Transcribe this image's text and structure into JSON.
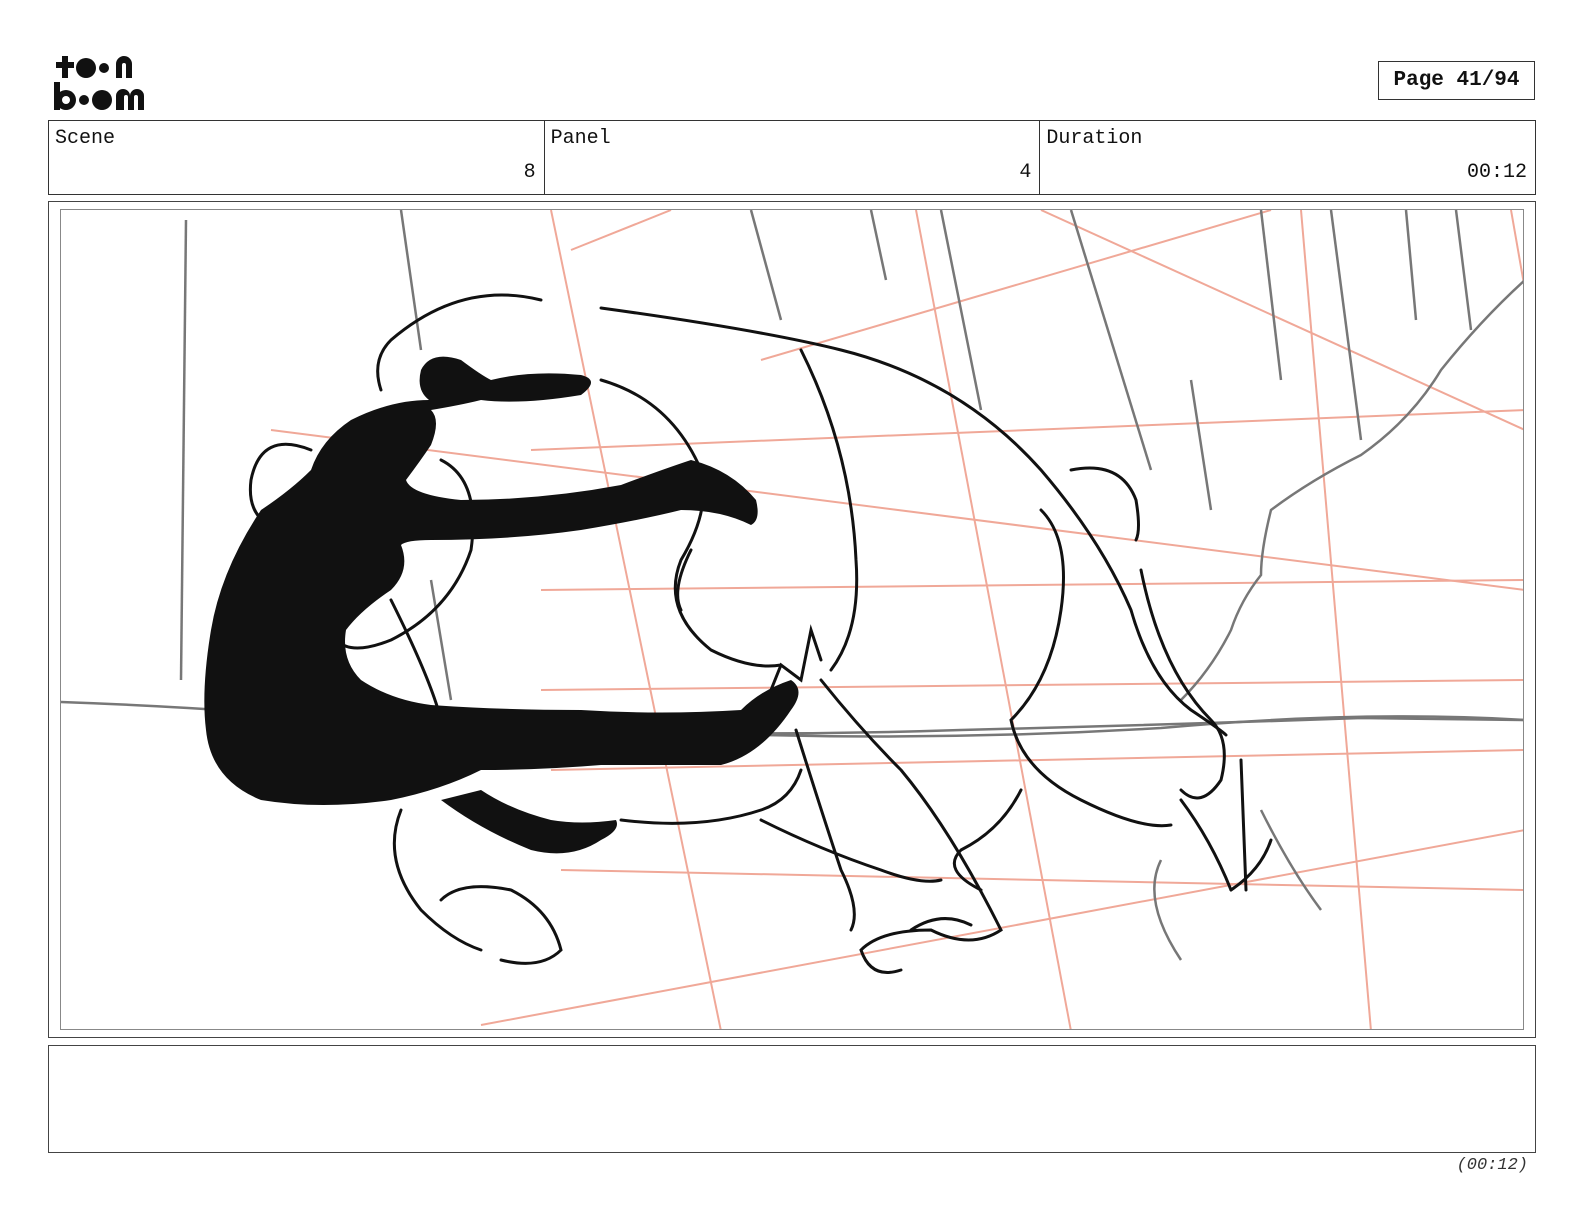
{
  "logo": {
    "text": "toon boom",
    "icon": "toon-boom-logo"
  },
  "page": {
    "label": "Page 41/94"
  },
  "info": {
    "scene_label": "Scene",
    "scene_value": "8",
    "panel_label": "Panel",
    "panel_value": "4",
    "duration_label": "Duration",
    "duration_value": "00:12"
  },
  "footer": {
    "duration": "(00:12)"
  },
  "colors": {
    "guide_lines": "#f0a898",
    "sketch": "#111111",
    "background_lines": "#777777"
  }
}
